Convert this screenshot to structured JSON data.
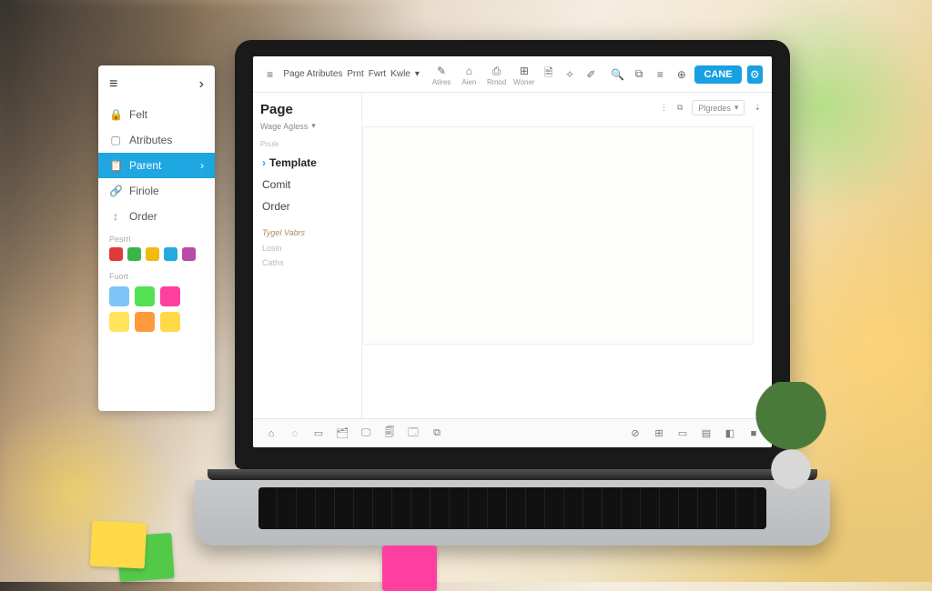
{
  "sidebar": {
    "items": [
      {
        "icon": "🔒",
        "label": "Felt"
      },
      {
        "icon": "▢",
        "label": "Atributes"
      },
      {
        "icon": "📋",
        "label": "Parent"
      },
      {
        "icon": "🔗",
        "label": "Firiole"
      },
      {
        "icon": "↕",
        "label": "Order"
      }
    ],
    "section1": "Pesrri",
    "brand_icons": [
      "#e03a3a",
      "#3ab54a",
      "#f2b90f",
      "#26a9e0",
      "#b84aa8"
    ],
    "section2": "Fuort",
    "swatches": [
      "#7fc4f7",
      "#53e053",
      "#ff3fa0",
      "#ffe35b",
      "#ff9a3b",
      "#ffd948"
    ]
  },
  "toolbar": {
    "breadcrumb": [
      "Page Atributes",
      "Prnt",
      "Fwrt",
      "Kwle"
    ],
    "icons": [
      {
        "glyph": "✎",
        "label": "Atires"
      },
      {
        "glyph": "⌂",
        "label": "Aien"
      },
      {
        "glyph": "⎙",
        "label": "Rmod"
      },
      {
        "glyph": "⊞",
        "label": "Woner"
      },
      {
        "glyph": "🗎",
        "label": ""
      },
      {
        "glyph": "✧",
        "label": ""
      },
      {
        "glyph": "✐",
        "label": ""
      }
    ],
    "right_icons": [
      "🔍",
      "⧉",
      "≡",
      "⊕"
    ],
    "primary": "CANE"
  },
  "page_panel": {
    "title": "Page",
    "dropdown": "Wage Agless",
    "mini": "Pnule",
    "attrs": [
      "Template",
      "Comit",
      "Order"
    ],
    "sub1": "Tygel Vabrs",
    "sub2": "Losin",
    "sub3": "Caths"
  },
  "doc_toolbar": {
    "menu": "⋮",
    "copy": "⧉",
    "pill": "Plgredes",
    "dl": "⇣"
  },
  "bottombar": {
    "left": [
      "⌂",
      "◌",
      "▭",
      "🗂",
      "🖵",
      "🗐",
      "🗔",
      "⧉"
    ],
    "right": [
      "⊘",
      "⊞",
      "▭",
      "▤",
      "◧",
      "■"
    ]
  }
}
